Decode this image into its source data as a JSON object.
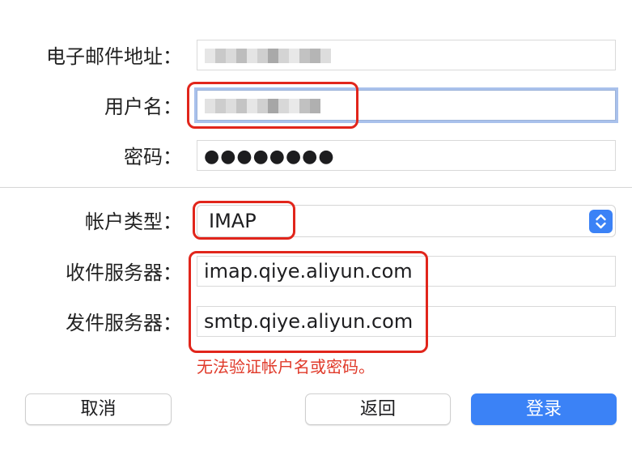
{
  "form": {
    "email": {
      "label": "电子邮件地址："
    },
    "username": {
      "label": "用户名："
    },
    "password": {
      "label": "密码：",
      "value": "●●●●●●●●"
    },
    "account_type": {
      "label": "帐户类型：",
      "value": "IMAP"
    },
    "incoming_server": {
      "label": "收件服务器：",
      "value": "imap.qiye.aliyun.com"
    },
    "outgoing_server": {
      "label": "发件服务器：",
      "value": "smtp.qiye.aliyun.com"
    },
    "error_message": "无法验证帐户名或密码。"
  },
  "buttons": {
    "cancel": "取消",
    "back": "返回",
    "login": "登录"
  },
  "colors": {
    "accent": "#3b82f6",
    "error": "#e03a2a",
    "annotation": "#e1251b",
    "focus_ring": "#a9c1ec"
  },
  "icons": {
    "popup_arrows": "chevron-up-down-icon"
  }
}
